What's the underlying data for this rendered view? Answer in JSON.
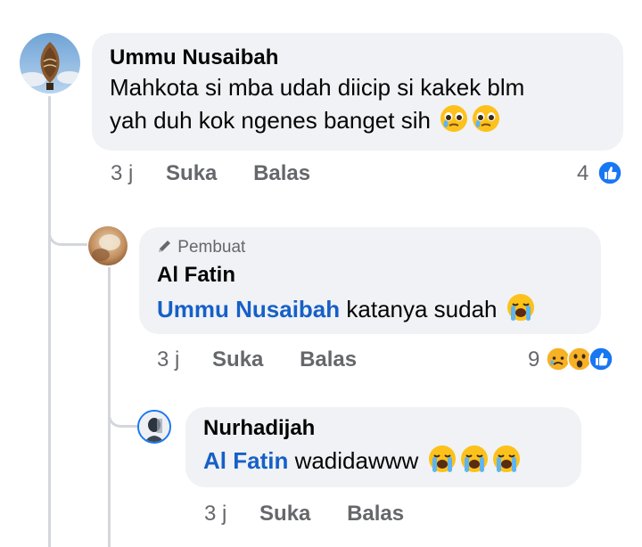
{
  "comments": [
    {
      "author": "Ummu Nusaibah",
      "text_line1": "Mahkota si mba udah diicip si kakek blm",
      "text_line2": "yah duh kok ngenes banget sih",
      "time": "3 j",
      "like_label": "Suka",
      "reply_label": "Balas",
      "reaction_count": "4",
      "reactions": [
        "like-icon"
      ],
      "text_emojis": [
        "pleading-face-icon",
        "pleading-face-icon"
      ]
    },
    {
      "badge": "Pembuat",
      "author": "Al Fatin",
      "mention": "Ummu Nusaibah",
      "text": " katanya sudah",
      "time": "3 j",
      "like_label": "Suka",
      "reply_label": "Balas",
      "reaction_count": "9",
      "reactions": [
        "sad-icon",
        "wow-icon",
        "like-icon"
      ],
      "text_emojis": [
        "loudly-crying-face-icon"
      ]
    },
    {
      "author": "Nurhadijah",
      "mention": "Al Fatin",
      "text": " wadidawww",
      "time": "3 j",
      "like_label": "Suka",
      "reply_label": "Balas",
      "text_emojis": [
        "loudly-crying-face-icon",
        "loudly-crying-face-icon",
        "loudly-crying-face-icon"
      ]
    }
  ],
  "colors": {
    "bubble": "#f0f2f5",
    "mention": "#1660c7",
    "meta": "#65676b",
    "like": "#1877f2",
    "thread": "#d3d6db"
  }
}
